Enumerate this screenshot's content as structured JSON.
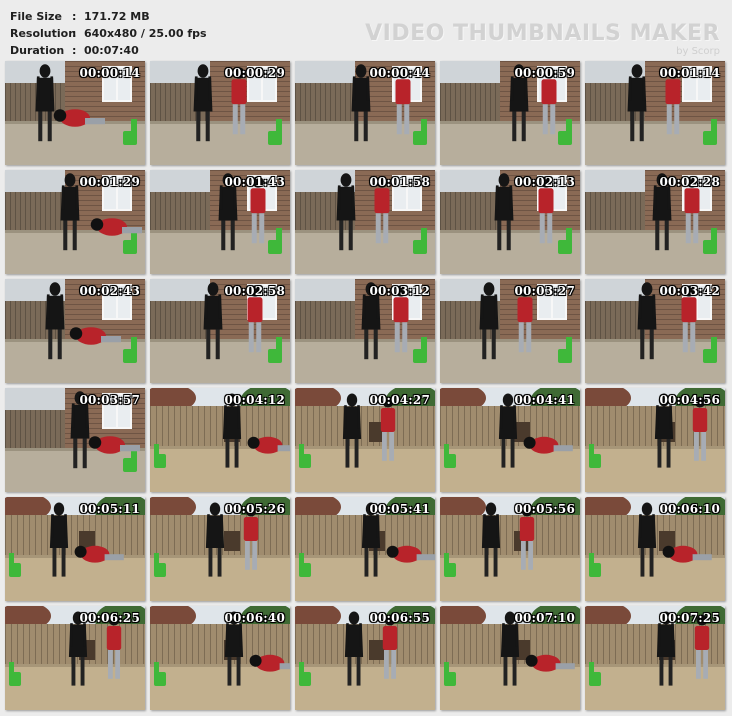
{
  "info": {
    "rows": [
      {
        "label": "File Size",
        "value": "171.72 MB"
      },
      {
        "label": "Resolution",
        "value": "640x480 / 25.00 fps"
      },
      {
        "label": "Duration",
        "value": "00:07:40"
      }
    ]
  },
  "brand": {
    "title": "VIDEO THUMBNAILS MAKER",
    "subtitle": "by Scorp"
  },
  "thumbnails": [
    {
      "time": "00:00:14",
      "scene": "patio",
      "figures": 2
    },
    {
      "time": "00:00:29",
      "scene": "patio",
      "figures": 2
    },
    {
      "time": "00:00:44",
      "scene": "patio",
      "figures": 2
    },
    {
      "time": "00:00:59",
      "scene": "patio",
      "figures": 2
    },
    {
      "time": "00:01:14",
      "scene": "patio",
      "figures": 2
    },
    {
      "time": "00:01:29",
      "scene": "patio",
      "figures": 2
    },
    {
      "time": "00:01:43",
      "scene": "patio",
      "figures": 2
    },
    {
      "time": "00:01:58",
      "scene": "patio",
      "figures": 2
    },
    {
      "time": "00:02:13",
      "scene": "patio",
      "figures": 2
    },
    {
      "time": "00:02:28",
      "scene": "patio",
      "figures": 2
    },
    {
      "time": "00:02:43",
      "scene": "patio",
      "figures": 2
    },
    {
      "time": "00:02:58",
      "scene": "patio",
      "figures": 2
    },
    {
      "time": "00:03:12",
      "scene": "patio",
      "figures": 2
    },
    {
      "time": "00:03:27",
      "scene": "patio",
      "figures": 2
    },
    {
      "time": "00:03:42",
      "scene": "patio",
      "figures": 2
    },
    {
      "time": "00:03:57",
      "scene": "patio",
      "figures": 2
    },
    {
      "time": "00:04:12",
      "scene": "yard",
      "figures": 2
    },
    {
      "time": "00:04:27",
      "scene": "yard",
      "figures": 2
    },
    {
      "time": "00:04:41",
      "scene": "yard",
      "figures": 2
    },
    {
      "time": "00:04:56",
      "scene": "yard",
      "figures": 2
    },
    {
      "time": "00:05:11",
      "scene": "yard",
      "figures": 2
    },
    {
      "time": "00:05:26",
      "scene": "yard",
      "figures": 2
    },
    {
      "time": "00:05:41",
      "scene": "yard",
      "figures": 2
    },
    {
      "time": "00:05:56",
      "scene": "yard",
      "figures": 2
    },
    {
      "time": "00:06:10",
      "scene": "yard",
      "figures": 2
    },
    {
      "time": "00:06:25",
      "scene": "yard",
      "figures": 2
    },
    {
      "time": "00:06:40",
      "scene": "yard",
      "figures": 2
    },
    {
      "time": "00:06:55",
      "scene": "yard",
      "figures": 2
    },
    {
      "time": "00:07:10",
      "scene": "yard",
      "figures": 2
    },
    {
      "time": "00:07:25",
      "scene": "yard",
      "figures": 2
    }
  ],
  "colors": {
    "background": "#ececec",
    "brick": "#8a6a55",
    "fence": "#7a6a58",
    "ground_patio": "#b7ae9c",
    "ground_yard": "#c2b08e",
    "foliage": "#3f6a34",
    "figure_dark": "#151515",
    "figure_red": "#b8232a",
    "chair_green": "#3fb83a"
  }
}
